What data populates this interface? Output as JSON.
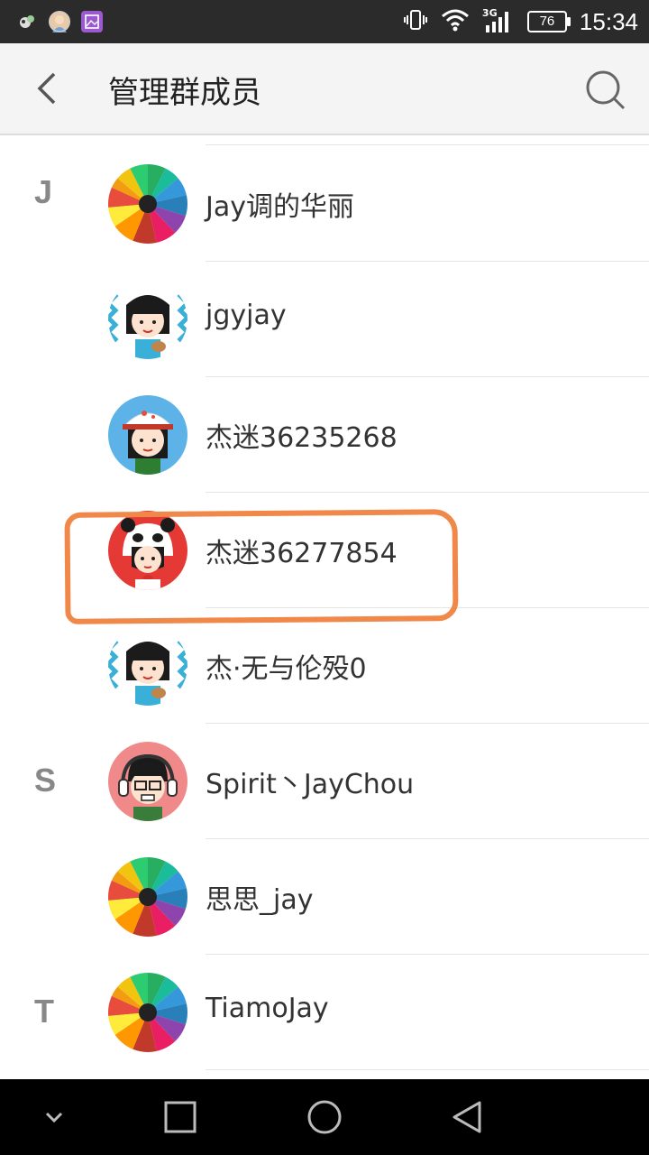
{
  "status_bar": {
    "time": "15:34",
    "battery": "76",
    "network": "3G",
    "left_icons": [
      "app-notification-icon",
      "avatar-notification-icon",
      "gallery-notification-icon"
    ],
    "right_icons": [
      "vibrate-icon",
      "wifi-icon",
      "signal-icon",
      "battery-icon"
    ]
  },
  "header": {
    "title": "管理群成员",
    "back_icon": "chevron-left-icon",
    "search_icon": "search-icon"
  },
  "members": [
    {
      "section": "J",
      "name": "Jay调的华丽",
      "avatar": "pencils"
    },
    {
      "section": "",
      "name": "jgyjay",
      "avatar": "girl-guitar"
    },
    {
      "section": "",
      "name": "杰迷36235268",
      "avatar": "cap-girl"
    },
    {
      "section": "",
      "name": "杰迷36277854",
      "avatar": "panda-hood",
      "highlighted": true
    },
    {
      "section": "",
      "name": "杰·无与伦殁0",
      "avatar": "girl-guitar"
    },
    {
      "section": "S",
      "name": "Spirit丶JayChou",
      "avatar": "headphones-boy"
    },
    {
      "section": "",
      "name": "思思_jay",
      "avatar": "pencils"
    },
    {
      "section": "T",
      "name": "TiamoJay",
      "avatar": "pencils"
    }
  ],
  "colors": {
    "highlight_stroke": "#f0884a",
    "status_bar_bg": "#2b2b2b",
    "app_bar_bg": "#f4f4f4",
    "nav_bar_bg": "#000000"
  },
  "nav_bar": {
    "buttons": [
      "down-chevron-icon",
      "recents-square-icon",
      "home-circle-icon",
      "back-triangle-icon"
    ]
  }
}
